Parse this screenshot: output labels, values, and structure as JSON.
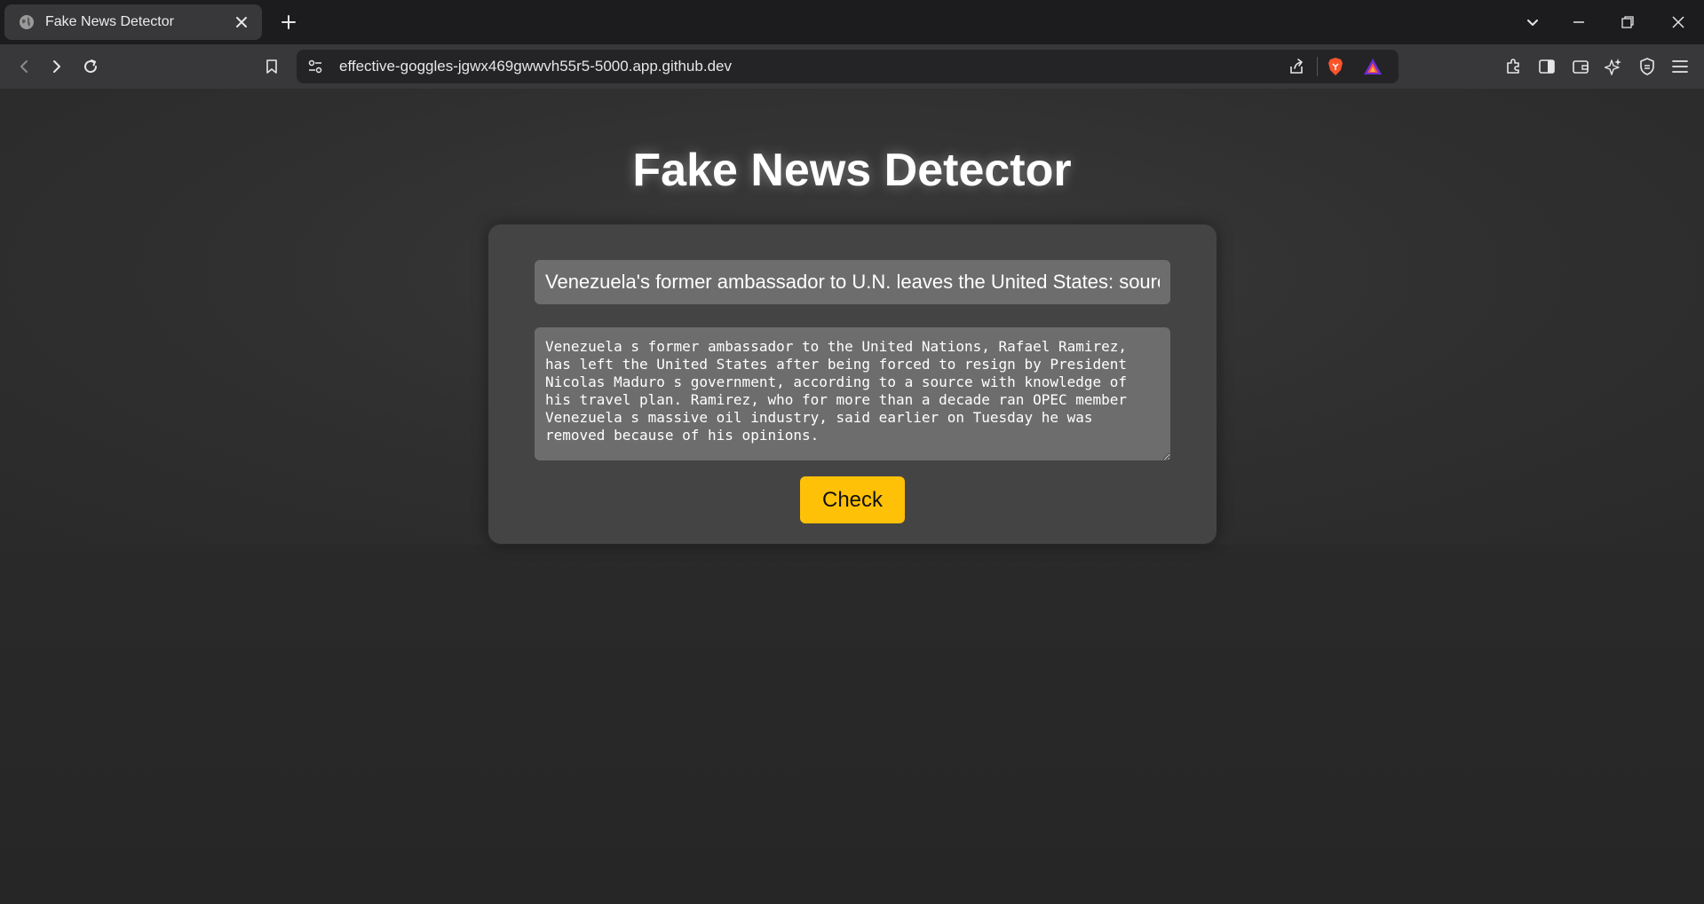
{
  "browser": {
    "tab": {
      "title": "Fake News Detector"
    },
    "address_bar": {
      "url": "effective-goggles-jgwx469gwwvh55r5-5000.app.github.dev"
    }
  },
  "page": {
    "title": "Fake News Detector",
    "headline_input": {
      "value": "Venezuela's former ambassador to U.N. leaves the United States: source"
    },
    "article_textarea": {
      "value": "Venezuela s former ambassador to the United Nations, Rafael Ramirez, has left the United States after being forced to resign by President Nicolas Maduro s government, according to a source with knowledge of his travel plan. Ramirez, who for more than a decade ran OPEC member Venezuela s massive oil industry, said earlier on Tuesday he was removed because of his opinions."
    },
    "check_button": {
      "label": "Check"
    },
    "colors": {
      "button": "#ffc107",
      "card": "#444444",
      "field": "#6d6d6d",
      "background": "#2b2b2b"
    }
  }
}
